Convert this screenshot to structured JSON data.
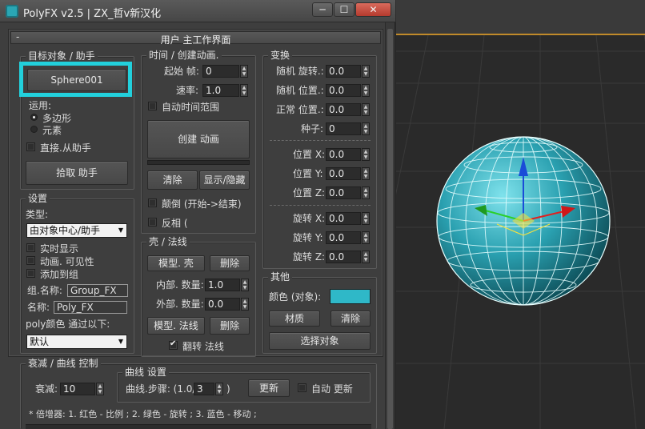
{
  "window": {
    "title": "PolyFX v2.5 | ZX_哲v新汉化",
    "min_glyph": "─",
    "max_glyph": "☐",
    "close_glyph": "✕"
  },
  "rollout": {
    "collapse_glyph": "-",
    "title": "用户 主工作界面"
  },
  "target": {
    "group_title": "目标对象 / 助手",
    "object_button": "Sphere001",
    "apply_label": "运用:",
    "radio_poly": "多边形",
    "radio_element": "元素",
    "direct_helper_label": "直接.从助手",
    "pick_helper_button": "拾取 助手"
  },
  "settings": {
    "group_title": "设置",
    "type_label": "类型:",
    "type_value": "由对象中心/助手",
    "realtime_label": "实时显示",
    "anim_visibility_label": "动画. 可见性",
    "add_to_group_label": "添加到组",
    "group_name_label": "组.名称:",
    "group_name_value": "Group_FX",
    "name_label": "名称:",
    "name_value": "Poly_FX",
    "poly_color_label": "poly颜色 通过以下:",
    "poly_color_value": "默认"
  },
  "time": {
    "group_title": "时间 / 创建动画.",
    "start_frame_label": "起始 帧:",
    "start_frame_value": "0",
    "rate_label": "速率:",
    "rate_value": "1.0",
    "auto_range_label": "自动时间范围",
    "create_anim_button": "创建 动画",
    "clear_button": "清除",
    "show_hide_button": "显示/隐藏",
    "reverse_label": "颠倒 (开始->结束)",
    "invert_label": "反相 ("
  },
  "shell": {
    "group_title": "壳 / 法线",
    "model_shell_button": "模型. 壳",
    "delete_shell_button": "删除",
    "inner_count_label": "内部. 数量:",
    "inner_count_value": "1.0",
    "outer_count_label": "外部. 数量:",
    "outer_count_value": "0.0",
    "model_normal_button": "模型. 法线",
    "delete_normal_button": "删除",
    "flip_normal_label": "翻转 法线"
  },
  "transform": {
    "group_title": "变换",
    "random_rotation_label": "随机 旋转.:",
    "random_rotation_value": "0.0",
    "random_position_label": "随机 位置.:",
    "random_position_value": "0.0",
    "normal_position_label": "正常 位置.:",
    "normal_position_value": "0.0",
    "seed_label": "种子:",
    "seed_value": "0",
    "pos_x_label": "位置 X:",
    "pos_x_value": "0.0",
    "pos_y_label": "位置 Y:",
    "pos_y_value": "0.0",
    "pos_z_label": "位置 Z:",
    "pos_z_value": "0.0",
    "rot_x_label": "旋转 X:",
    "rot_x_value": "0.0",
    "rot_y_label": "旋转 Y:",
    "rot_y_value": "0.0",
    "rot_z_label": "旋转 Z:",
    "rot_z_value": "0.0"
  },
  "other": {
    "group_title": "其他",
    "color_label": "颜色 (对象):",
    "color_swatch": "#2fb8c8",
    "material_button": "材质",
    "clear_button": "清除",
    "select_button": "选择对象"
  },
  "falloff": {
    "group_title": "衰减 / 曲线 控制",
    "falloff_label": "衰减:",
    "falloff_value": "10",
    "curve_group_title": "曲线 设置",
    "curve_steps_label": "曲线.步骤: (1.0/",
    "curve_steps_value": "3",
    "curve_steps_suffix": ")",
    "update_button": "更新",
    "auto_update_label": "自动 更新",
    "multiplier_note": "* 倍增器: 1. 红色 - 比例 ; 2. 绿色 - 旋转 ; 3. 蓝色 - 移动 ;"
  },
  "colors": {
    "highlight": "#22d0dc",
    "sphere": "#2aa0b0",
    "panel": "#3e3e3e"
  }
}
